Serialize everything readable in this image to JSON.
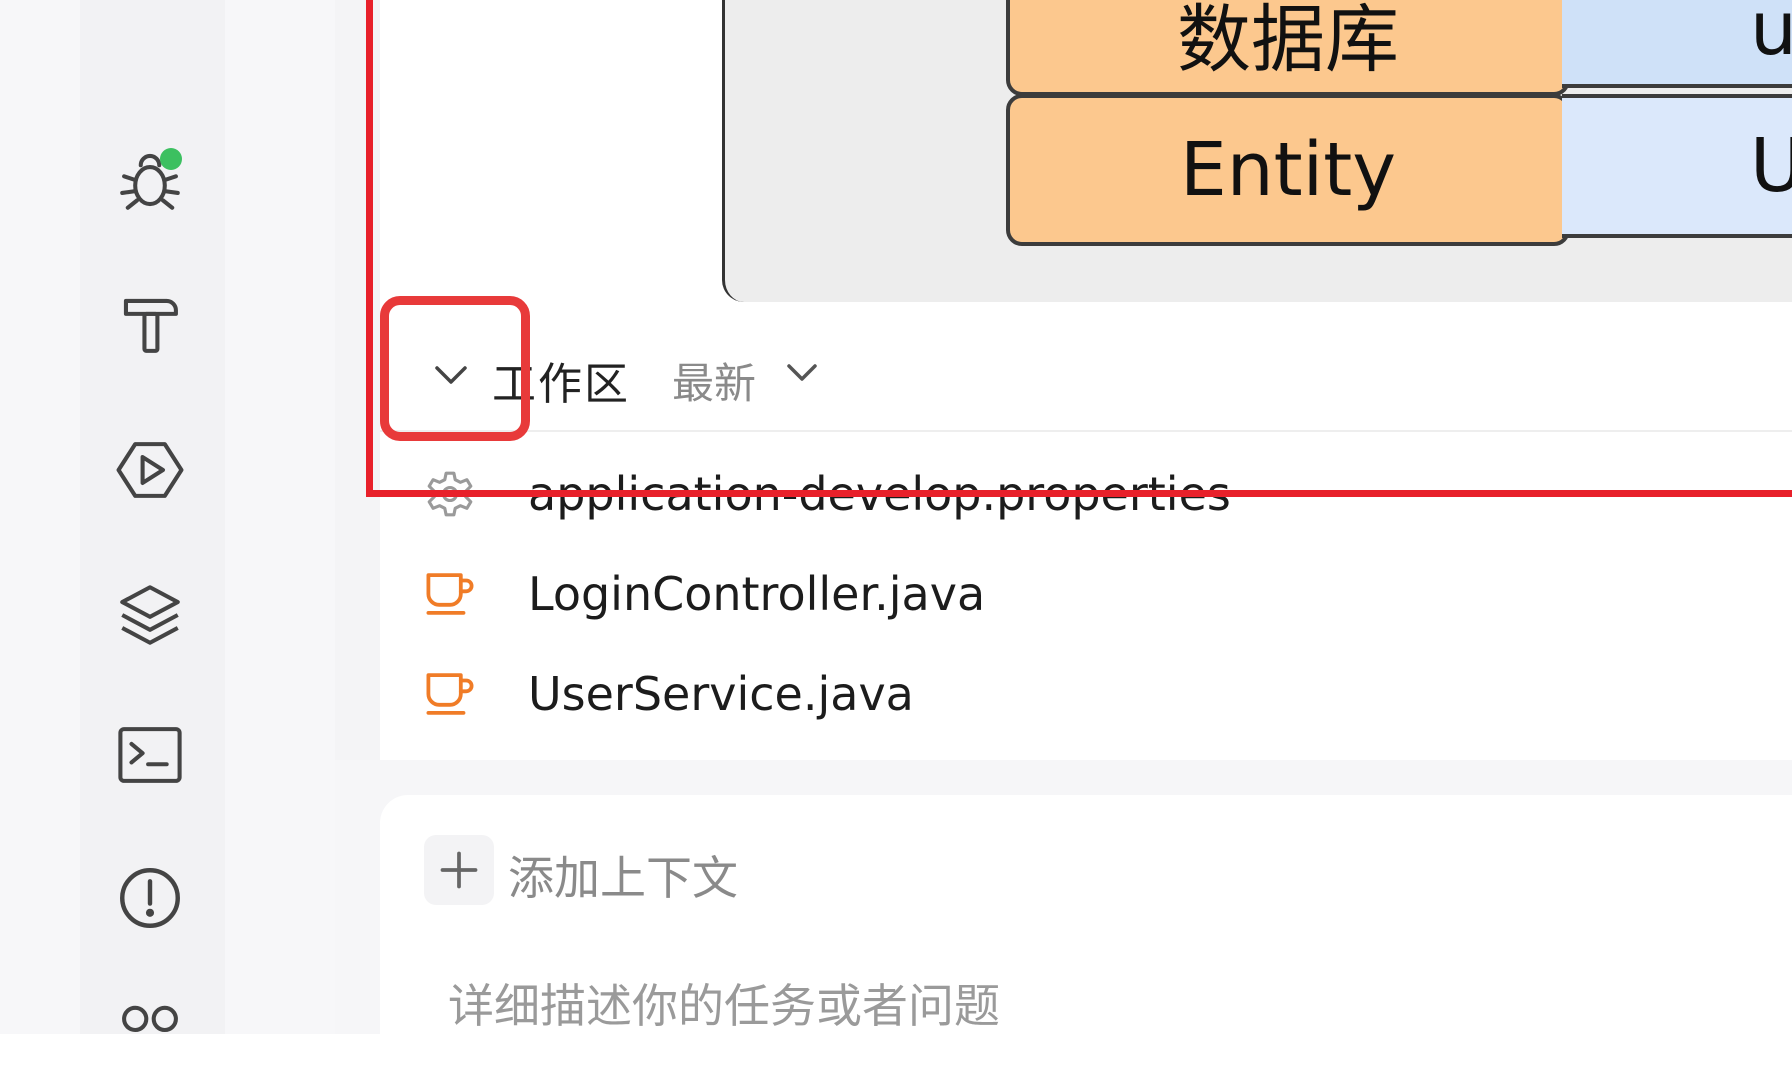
{
  "diagram": {
    "boxes": [
      {
        "label": "数据库",
        "color": "#fcc88e"
      },
      {
        "label": "Entity",
        "color": "#fcc88e"
      },
      {
        "label": "u",
        "color": "#cfe1f8"
      },
      {
        "label": "U",
        "color": "#dbe8fb"
      }
    ]
  },
  "workspace": {
    "title": "工作区",
    "filter": "最新",
    "files": [
      {
        "name": "application-develop.properties",
        "icon": "gear-icon"
      },
      {
        "name": "LoginController.java",
        "icon": "java-cup-icon"
      },
      {
        "name": "UserService.java",
        "icon": "java-cup-icon"
      }
    ]
  },
  "input": {
    "add_context_label": "添加上下文",
    "placeholder": "详细描述你的任务或者问题"
  },
  "activity_bar": {
    "icons": [
      "debug-bug-icon",
      "build-hammer-icon",
      "run-icon",
      "layers-icon",
      "terminal-icon",
      "problems-icon",
      "people-icon"
    ],
    "status_dot_color": "#3cc060"
  },
  "colors": {
    "annotation": "#e8202a",
    "java_icon": "#f07c27"
  }
}
